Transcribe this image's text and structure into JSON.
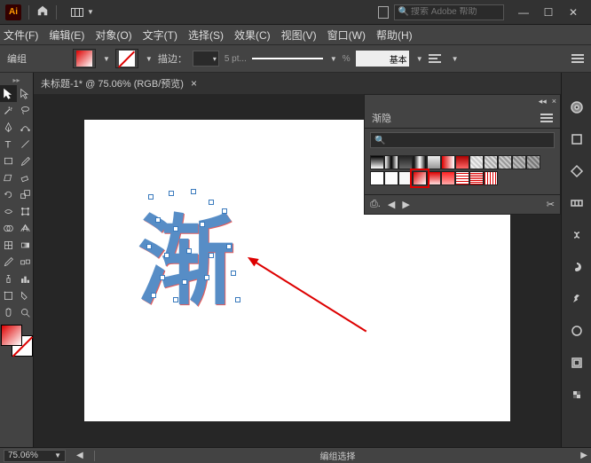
{
  "titlebar": {
    "logo": "Ai",
    "search_placeholder": "搜索 Adobe 帮助",
    "search_icon_glyph": "🔍"
  },
  "menubar": {
    "file": "文件(F)",
    "edit": "编辑(E)",
    "object": "对象(O)",
    "type": "文字(T)",
    "select": "选择(S)",
    "effect": "效果(C)",
    "view": "视图(V)",
    "window": "窗口(W)",
    "help": "帮助(H)"
  },
  "controlbar": {
    "mode_label": "编组",
    "stroke_label": "描边：",
    "stroke_value": "",
    "opacity_label": "5 pt...",
    "style_label": "基本",
    "pct_suffix": "%"
  },
  "doctab": {
    "title": "未标题-1* @ 75.06% (RGB/预览)"
  },
  "panel": {
    "tab_label": "渐隐",
    "search_glyph": "🔍"
  },
  "artwork": {
    "text": "渐"
  },
  "statusbar": {
    "zoom": "75.06%",
    "selection_label": "编组选择"
  },
  "colors": {
    "accent_red": "#d00",
    "sel_blue": "#3a7abd"
  }
}
